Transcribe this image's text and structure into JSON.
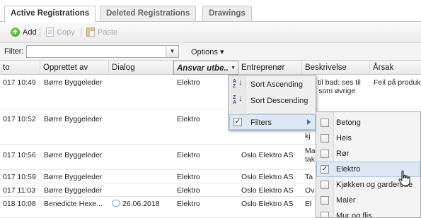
{
  "tabs": [
    {
      "label": "Active Registrations",
      "active": true
    },
    {
      "label": "Deleted Registrations",
      "active": false
    },
    {
      "label": "Drawings",
      "active": false
    }
  ],
  "toolbar": {
    "add_label": "Add",
    "copy_label": "Copy",
    "paste_label": "Paste",
    "add_icon": "add-icon",
    "copy_icon": "copy-icon",
    "paste_icon": "paste-icon"
  },
  "filter": {
    "label": "Filter:",
    "value": "",
    "options_label": "Options ▾"
  },
  "grid": {
    "headers": [
      "to",
      "Opprettet av",
      "Dialog",
      "Ansvar utbe..",
      "Entreprenør",
      "Beskrivelse",
      "Årsak"
    ],
    "rows": [
      {
        "date": "017 10:49",
        "created_by": "Børre Byggeleder",
        "dialog": "",
        "responsible": "Elektro",
        "contractor": "",
        "description": "tter til bad: ses til hvit som øvrige",
        "cause": "Feil på produkt"
      },
      {
        "date": "017 10:52",
        "created_by": "Børre Byggeleder",
        "dialog": "",
        "responsible": "Elektro",
        "contractor": "",
        "description": "kj",
        "cause": ""
      },
      {
        "date": "017 10:56",
        "created_by": "Børre Byggeleder",
        "dialog": "",
        "responsible": "Elektro",
        "contractor": "Oslo Elektro AS",
        "description": "Ma tak",
        "cause": ""
      },
      {
        "date": "017 10:59",
        "created_by": "Børre Byggeleder",
        "dialog": "",
        "responsible": "Elektro",
        "contractor": "Oslo Elektro AS",
        "description": "Ta",
        "cause": ""
      },
      {
        "date": "017 11:03",
        "created_by": "Børre Byggeleder",
        "dialog": "",
        "responsible": "Elektro",
        "contractor": "Oslo Elektro AS",
        "description": "Ov",
        "cause": ""
      },
      {
        "date": "018 10:08",
        "created_by": "Benedicte Hexe...",
        "dialog": "26.06.2018",
        "responsible": "Elektro",
        "contractor": "Oslo Elektro AS",
        "description": "El",
        "cause": ""
      }
    ]
  },
  "column_menu": {
    "sort_asc": "Sort Ascending",
    "sort_desc": "Sort Descending",
    "filters": "Filters"
  },
  "filter_submenu": {
    "items": [
      {
        "label": "Betong",
        "checked": false
      },
      {
        "label": "Heis",
        "checked": false
      },
      {
        "label": "Rør",
        "checked": false
      },
      {
        "label": "Elektro",
        "checked": true
      },
      {
        "label": "Kjøkken og garderobe",
        "checked": false
      },
      {
        "label": "Maler",
        "checked": false
      },
      {
        "label": "Mur og flis",
        "checked": false
      }
    ]
  },
  "colors": {
    "accent": "#3a6fb5",
    "highlight": "#dce8f6"
  }
}
